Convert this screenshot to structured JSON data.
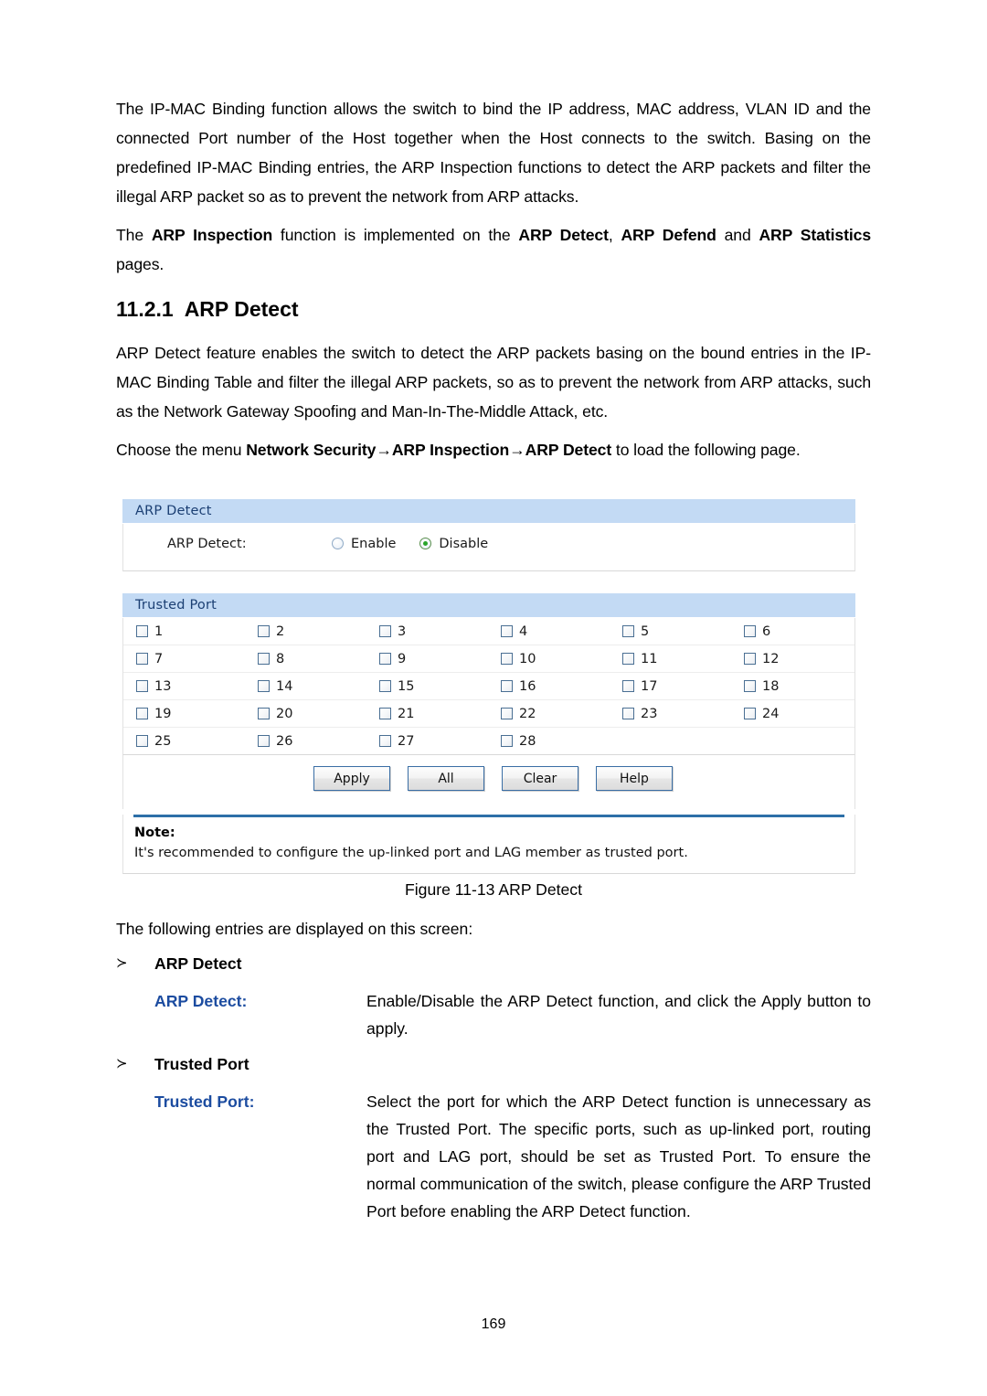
{
  "document": {
    "page_number": "169",
    "paragraphs": [
      "The IP-MAC Binding function allows the switch to bind the IP address, MAC address, VLAN ID and the connected Port number of the Host together when the Host connects to the switch. Basing on the predefined IP-MAC Binding entries, the ARP Inspection functions to detect the ARP packets and filter the illegal ARP packet so as to prevent the network from ARP attacks."
    ],
    "inspection_sentence": {
      "part1": "The ",
      "bold1": "ARP Inspection",
      "part2": " function is implemented on the ",
      "bold2": "ARP Detect",
      "part3": ", ",
      "bold3": "ARP Defend",
      "part4": " and ",
      "bold4": "ARP Statistics",
      "part5": " pages."
    },
    "section": {
      "number": "11.2.1",
      "title": "ARP Detect"
    },
    "feature_paragraph": "ARP Detect feature enables the switch to detect the ARP packets basing on the bound entries in the IP-MAC Binding Table and filter the illegal ARP packets, so as to prevent the network from ARP attacks, such as the Network Gateway Spoofing and Man-In-The-Middle Attack, etc.",
    "menu_sentence": {
      "part1": "Choose the menu ",
      "bold1": "Network Security",
      "arrow1": "→",
      "bold2": "ARP Inspection",
      "arrow2": "→",
      "bold3": "ARP Detect",
      "part2": " to load the following page."
    },
    "figure_caption": "Figure 11-13 ARP Detect",
    "lead_line": "The following entries are displayed on this screen:",
    "bullet_marker": "≻",
    "entries": [
      {
        "heading": "ARP Detect",
        "term": "ARP Detect:",
        "description": "Enable/Disable the ARP Detect function, and click the Apply button to apply."
      },
      {
        "heading": "Trusted Port",
        "term": "Trusted Port:",
        "description": "Select the port for which the ARP Detect function is unnecessary as the Trusted Port. The specific ports, such as up-linked port, routing port and LAG port, should be set as Trusted Port. To ensure the normal communication of the switch, please configure the ARP Trusted Port before enabling the ARP Detect function."
      }
    ]
  },
  "ui": {
    "arp_detect_panel": {
      "header": "ARP Detect",
      "field_label": "ARP Detect:",
      "radios": [
        {
          "label": "Enable",
          "selected": false
        },
        {
          "label": "Disable",
          "selected": true
        }
      ]
    },
    "trusted_port_panel": {
      "header": "Trusted Port",
      "columns": 6,
      "ports": [
        {
          "number": "1",
          "checked": false
        },
        {
          "number": "2",
          "checked": false
        },
        {
          "number": "3",
          "checked": false
        },
        {
          "number": "4",
          "checked": false
        },
        {
          "number": "5",
          "checked": false
        },
        {
          "number": "6",
          "checked": false
        },
        {
          "number": "7",
          "checked": false
        },
        {
          "number": "8",
          "checked": false
        },
        {
          "number": "9",
          "checked": false
        },
        {
          "number": "10",
          "checked": false
        },
        {
          "number": "11",
          "checked": false
        },
        {
          "number": "12",
          "checked": false
        },
        {
          "number": "13",
          "checked": false
        },
        {
          "number": "14",
          "checked": false
        },
        {
          "number": "15",
          "checked": false
        },
        {
          "number": "16",
          "checked": false
        },
        {
          "number": "17",
          "checked": false
        },
        {
          "number": "18",
          "checked": false
        },
        {
          "number": "19",
          "checked": false
        },
        {
          "number": "20",
          "checked": false
        },
        {
          "number": "21",
          "checked": false
        },
        {
          "number": "22",
          "checked": false
        },
        {
          "number": "23",
          "checked": false
        },
        {
          "number": "24",
          "checked": false
        },
        {
          "number": "25",
          "checked": false
        },
        {
          "number": "26",
          "checked": false
        },
        {
          "number": "27",
          "checked": false
        },
        {
          "number": "28",
          "checked": false
        }
      ]
    },
    "buttons": [
      {
        "label": "Apply",
        "name": "apply-button"
      },
      {
        "label": "All",
        "name": "all-button"
      },
      {
        "label": "Clear",
        "name": "clear-button"
      },
      {
        "label": "Help",
        "name": "help-button"
      }
    ],
    "note": {
      "title": "Note:",
      "text": "It's recommended to configure the up-linked port and LAG member as trusted port."
    }
  },
  "colors": {
    "panel_header_bg": "#c3daf4",
    "panel_header_text": "#1b3f73",
    "accent_blue": "#1c4ca0",
    "separator_blue": "#2d6fa8",
    "radio_selected": "#2aa52a"
  }
}
